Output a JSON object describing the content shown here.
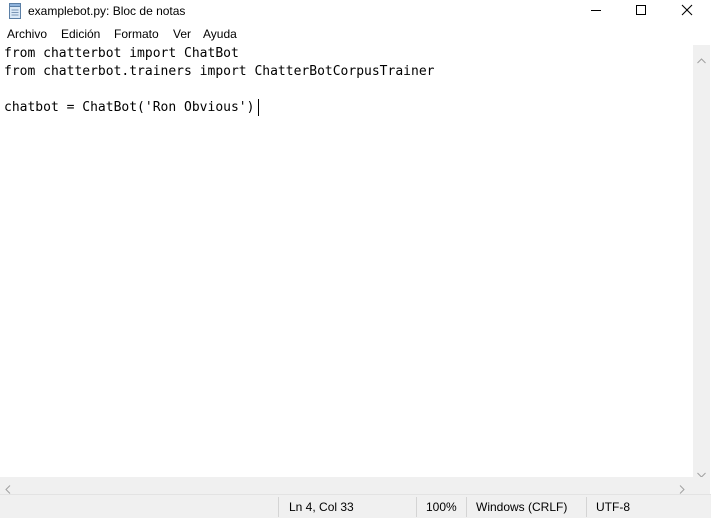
{
  "window": {
    "title": "examplebot.py: Bloc de notas",
    "app_icon": "notepad-icon",
    "controls": [
      "minimize-icon",
      "maximize-icon",
      "close-icon"
    ]
  },
  "menu": {
    "items": [
      {
        "label": "Archivo"
      },
      {
        "label": "Edición"
      },
      {
        "label": "Formato"
      },
      {
        "label": "Ver"
      },
      {
        "label": "Ayuda"
      }
    ]
  },
  "editor": {
    "lines": [
      "from chatterbot import ChatBot",
      "from chatterbot.trainers import ChatterBotCorpusTrainer",
      "",
      "chatbot = ChatBot('Ron Obvious')"
    ]
  },
  "status": {
    "position": "Ln 4, Col 33",
    "zoom": "100%",
    "line_ending": "Windows (CRLF)",
    "encoding": "UTF-8"
  }
}
